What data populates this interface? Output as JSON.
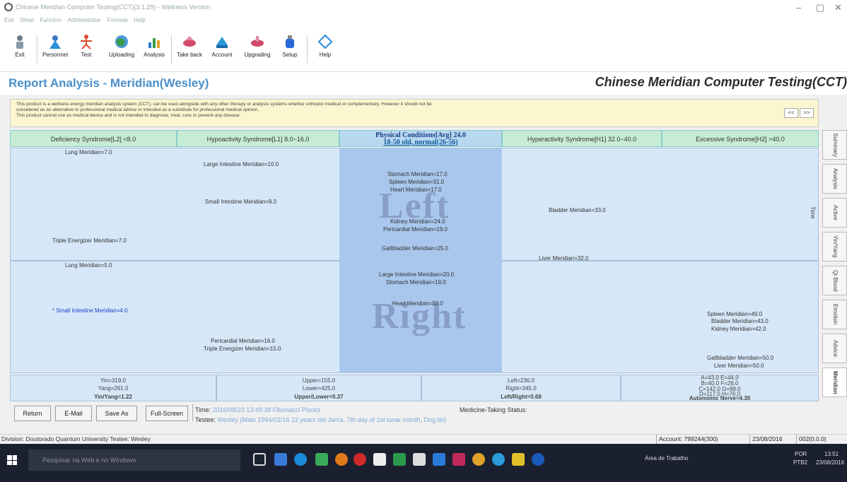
{
  "window": {
    "title": "Chinese Meridian Computer Testing(CCT)(3.1.29) - Wellness Version",
    "controls": [
      "–",
      "▢",
      "✕"
    ]
  },
  "menu": [
    "Exit",
    "Show",
    "Function",
    "Administrator",
    "Formula",
    "Help"
  ],
  "toolbar": [
    {
      "label": "Exit",
      "icon": "exit-person-icon",
      "color": "#6a7a8a"
    },
    {
      "label": "Personnel",
      "icon": "personnel-icon",
      "color": "#2a8fd8"
    },
    {
      "label": "Test",
      "icon": "test-meridian-figure-icon",
      "color": "#e04a2a"
    },
    {
      "label": "Uploading",
      "icon": "globe-upload-icon",
      "color": "#3a9a4a"
    },
    {
      "label": "Analysis",
      "icon": "bar-chart-icon",
      "color": "#2a7ad8"
    },
    {
      "label": "Take back",
      "icon": "take-back-icon",
      "color": "#d04a6a"
    },
    {
      "label": "Account",
      "icon": "account-icon",
      "color": "#2a9ad8"
    },
    {
      "label": "Upgrading",
      "icon": "upgrading-icon",
      "color": "#d04a6a"
    },
    {
      "label": "Setup",
      "icon": "setup-bottle-icon",
      "color": "#2a6ad8"
    },
    {
      "label": "Help",
      "icon": "help-diamond-icon",
      "color": "#2a8ad8"
    }
  ],
  "header": {
    "title": "Report Analysis - Meridian(Wesley)",
    "brand": "Chinese Meridian Computer Testing(CCT)"
  },
  "notice": {
    "lines": [
      "This product is a wellness energy meridian analysis system (CCT), can be used alongside with any other therapy or analysis systems whether orthodox medical or complementary. However it should not be",
      "considered as an alternative to professional medical advice or intended as a substitute for professional medical opinion.",
      "This product cannot use as medical device and is not intended to diagnose, treat, cure or prevent any disease."
    ],
    "prev": "<<",
    "next": ">>"
  },
  "columns": {
    "deficiency": "Deficiency Syndrome[L2] <8.0",
    "hypoactivity": "Hypoactivity Syndrome[L1] 8.0~16.0",
    "physical_line1": "Physical Conditions[Avg] 24.0",
    "physical_line2": "18-50 old, normal(26-56)",
    "hyperactivity": "Hyperactivity Syndrome[H1] 32.0~40.0",
    "excessive": "Excessive Syndrome[H2] >40.0"
  },
  "left": {
    "watermark": "Left",
    "items": {
      "lung": "Lung Meridian=7.0",
      "large_intestine": "Large Intestine Meridian=10.0",
      "small_intestine": "Small Intestine Meridian=9.0",
      "triple_energizer": "Triple Energizer Meridian=7.0",
      "stomach": "Stomach Meridian=17.0",
      "spleen": "Spleen Meridian=31.0",
      "heart": "Heart Meridian=17.0",
      "kidney": "Kidney Meridian=24.0",
      "pericardial": "Pericardial Meridian=19.0",
      "gallbladder": "Gallbladder Meridian=25.0",
      "bladder": "Bladder Meridian=33.0",
      "liver": "Liver Meridian=32.0"
    }
  },
  "right": {
    "watermark": "Right",
    "items": {
      "lung": "Lung Meridian=5.0",
      "small_intestine": "* Small Intestine Meridian=4.0",
      "pericardial": "Pericardial Meridian=16.0",
      "triple_energizer": "Triple Energizer Meridian=15.0",
      "large_intestine": "Large Intestine Meridian=20.0",
      "stomach": "Stomach Meridian=18.0",
      "heart": "Heart Meridian=22.0",
      "spleen": "Spleen Meridian=49.0",
      "bladder": "Bladder Meridian=43.0",
      "kidney": "Kidney Meridian=42.0",
      "gallbladder": "Gallbladder Meridian=50.0",
      "liver": "Liver Meridian=50.0"
    }
  },
  "summary": {
    "yin": "Yin=319.0",
    "yang": "Yang=261.0",
    "yin_yang": "Yin/Yang=1.22",
    "upper": "Upper=155.0",
    "lower": "Lower=425.0",
    "upper_lower": "Upper/Lower=0.37",
    "left": "Left=236.0",
    "right": "Right=345.0",
    "left_right": "Left/Right=0.68",
    "ae": "A=43.0  E=44.0",
    "bf": "B=40.0  F=26.0",
    "cg": "C=142.0  G=88.0",
    "dh": "D=117.0  H=76.0",
    "autonomic": "Autonomic Nerve=4.30"
  },
  "side_tabs": [
    "Summary",
    "Analysis",
    "Active Time",
    "Yin/Yang",
    "Qi Blood",
    "Emotion",
    "Advice",
    "Meridian"
  ],
  "buttons": {
    "return": "Return",
    "email": "E-Mail",
    "save_as": "Save As",
    "full_screen": "Full-Screen"
  },
  "test_info": {
    "time_label": "Time:",
    "time_value": "2016/08/23 13:49:38 Fibonacci Pisces",
    "testee_label": "Testee:",
    "testee_value": "Wesley (Male 1994/02/16 22 years old Jan/a. 7th day of 1st lunar month, Dog,fei)",
    "medicine_label": "Medicine-Taking Status:"
  },
  "statusbar": {
    "division": "Division: Doutorado Quantum University   Testee: Wesley",
    "account": "Account: 799244(300)",
    "date": "23/08/2016",
    "code": "002(0.0.0)"
  },
  "taskbar": {
    "search_placeholder": "Pesquisar na Web e no Windows",
    "tray_label": "Área de Trabalho",
    "lang": "POR",
    "lang2": "PTB2",
    "time": "13:51",
    "date": "23/08/2016"
  }
}
